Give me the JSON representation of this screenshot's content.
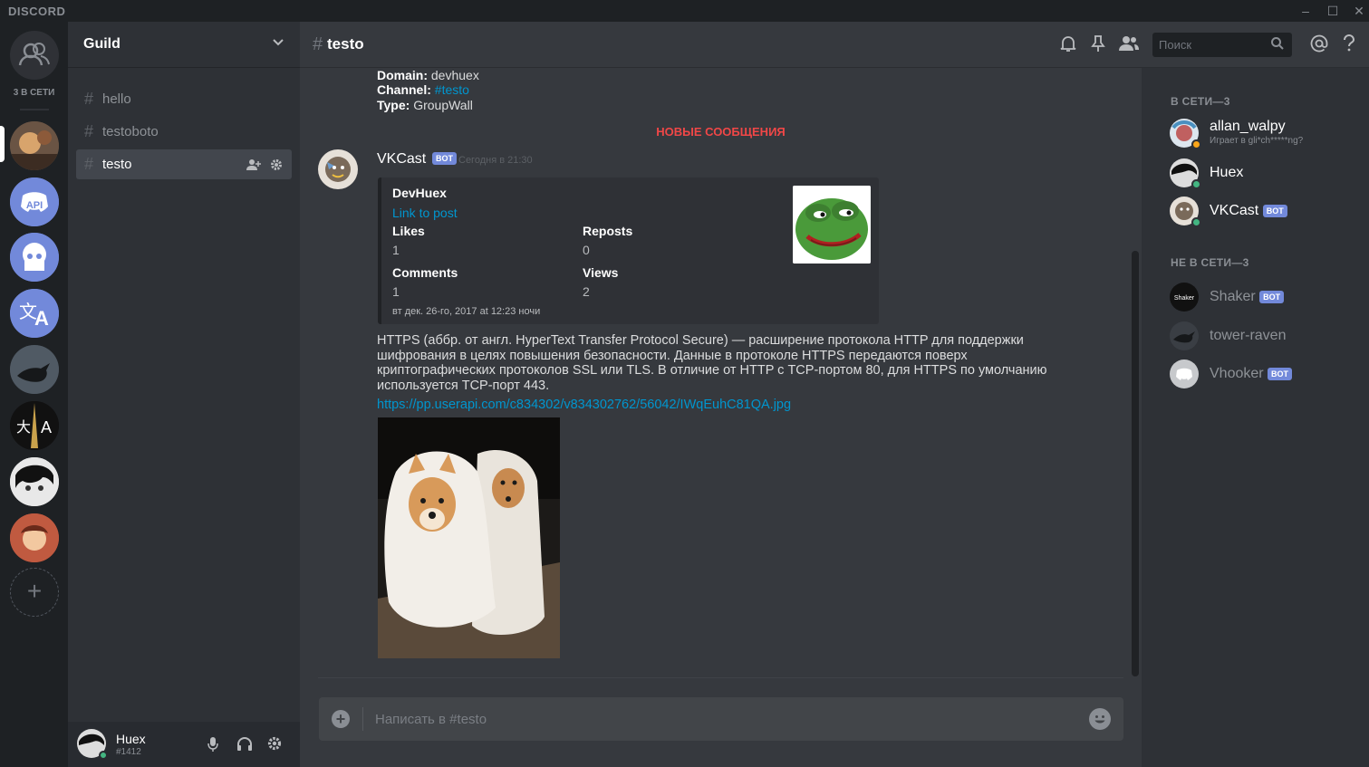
{
  "app": {
    "logo": "DISCORD"
  },
  "window": {
    "minimize": "–",
    "maximize": "☐",
    "close": "✕"
  },
  "guild_rail": {
    "online_count": "3 В СЕТИ"
  },
  "guild": {
    "name": "Guild"
  },
  "channels": [
    {
      "name": "hello",
      "active": false
    },
    {
      "name": "testoboto",
      "active": false
    },
    {
      "name": "testo",
      "active": true
    }
  ],
  "user": {
    "name": "Huex",
    "discriminator": "#1412"
  },
  "chat": {
    "channel_name": "testo",
    "search_placeholder": "Поиск",
    "composer_placeholder": "Написать в #testo"
  },
  "prev_embed": {
    "domain_label": "Domain:",
    "domain_value": "devhuex",
    "channel_label": "Channel:",
    "channel_value": "#testo",
    "type_label": "Type:",
    "type_value": "GroupWall"
  },
  "new_messages_divider": "НОВЫЕ СООБЩЕНИЯ",
  "message": {
    "author": "VKCast",
    "bot_tag": "BOT",
    "timestamp": "Сегодня в 21:30",
    "embed": {
      "title": "DevHuex",
      "link_text": "Link to post",
      "fields": [
        {
          "name": "Likes",
          "value": "1"
        },
        {
          "name": "Reposts",
          "value": "0"
        },
        {
          "name": "Comments",
          "value": "1"
        },
        {
          "name": "Views",
          "value": "2"
        }
      ],
      "footer": "вт дек. 26-го, 2017 at 12:23 ночи"
    },
    "text": "HTTPS (аббр. от англ. HyperText Transfer Protocol Secure) — расширение протокола HTTP для поддержки шифрования в целях повышения безопасности. Данные в протоколе HTTPS передаются поверх криптографических протоколов SSL или TLS. В отличие от HTTP с TCP-портом 80, для HTTPS по умолчанию используется TCP-порт 443.",
    "url": "https://pp.userapi.com/c834302/v834302762/56042/IWqEuhC81QA.jpg"
  },
  "members": {
    "online_header": "В СЕТИ—3",
    "offline_header": "НЕ В СЕТИ—3",
    "online": [
      {
        "name": "allan_walpy",
        "game": "Играет в gli*ch*****ng?",
        "bot": false,
        "status_color": "#faa61a"
      },
      {
        "name": "Huex",
        "bot": false,
        "status_color": "#43b581"
      },
      {
        "name": "VKCast",
        "bot": true,
        "bot_tag": "BOT",
        "status_color": "#43b581"
      }
    ],
    "offline": [
      {
        "name": "Shaker",
        "bot": true,
        "bot_tag": "BOT"
      },
      {
        "name": "tower-raven",
        "bot": false
      },
      {
        "name": "Vhooker",
        "bot": true,
        "bot_tag": "BOT"
      }
    ]
  },
  "colors": {
    "accent": "#7289da",
    "link": "#0096cf",
    "new_messages": "#f04747",
    "online": "#43b581"
  }
}
